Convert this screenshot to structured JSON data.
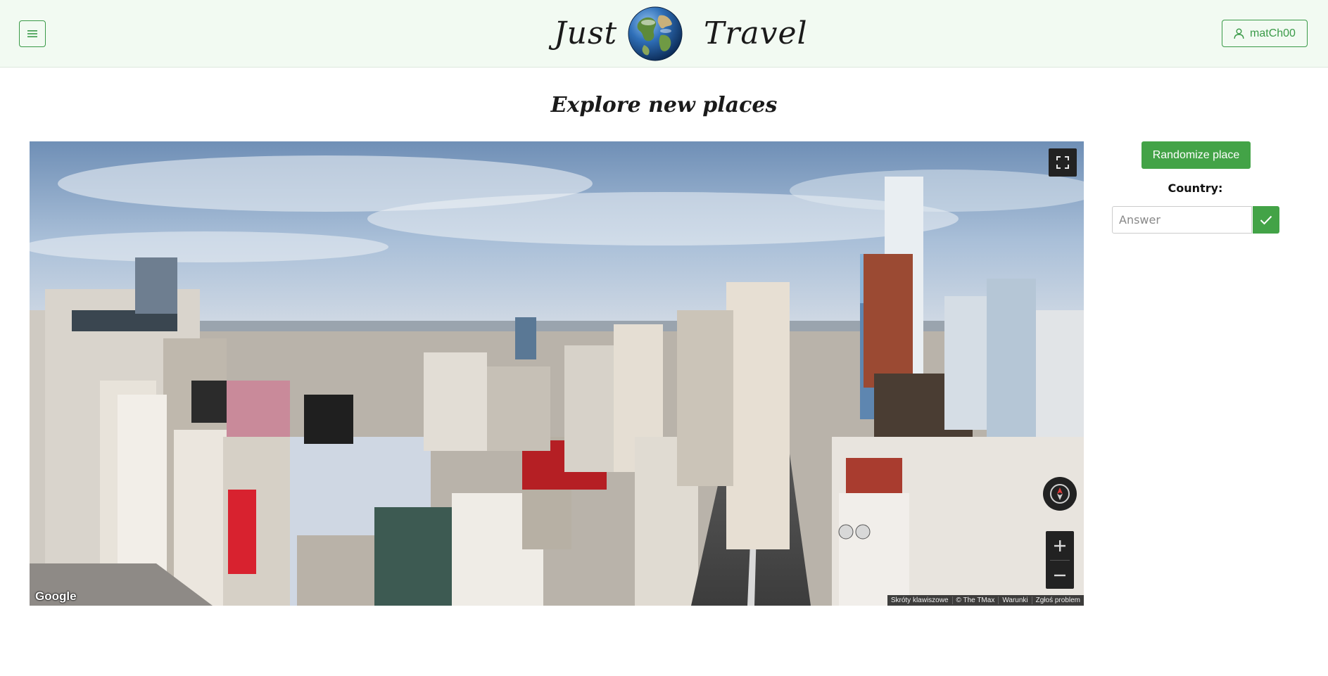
{
  "header": {
    "brand_left": "Just",
    "brand_right": "Travel",
    "user_name": "matCh00",
    "icons": {
      "menu": "hamburger-icon",
      "user": "user-icon",
      "logo": "globe-icon"
    }
  },
  "main": {
    "title": "Explore new places"
  },
  "street_view": {
    "logo_text": "Google",
    "attribution": [
      "Skróty klawiszowe",
      "© The TMax",
      "Warunki",
      "Zgłoś problem"
    ],
    "controls": {
      "fullscreen": "fullscreen-icon",
      "compass": "compass-icon",
      "zoom_in": "plus-icon",
      "zoom_out": "minus-icon"
    }
  },
  "side_panel": {
    "randomize_label": "Randomize place",
    "country_label": "Country:",
    "answer_placeholder": "Answer",
    "answer_value": "",
    "submit_icon": "check-icon"
  },
  "colors": {
    "accent": "#43a347",
    "accent_outline": "#3a9a48",
    "header_bg": "#f2faf2"
  }
}
